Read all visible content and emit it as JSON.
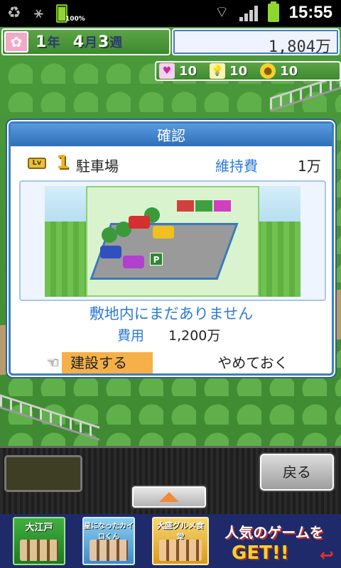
{
  "status_bar": {
    "battery_percent": "100%",
    "time": "15:55"
  },
  "hud": {
    "date": {
      "year": "1",
      "year_unit": "年",
      "month": "4",
      "month_unit": "月",
      "week": "3",
      "week_unit": "週"
    },
    "money": "1,804万",
    "stats": [
      {
        "icon": "heart-icon",
        "value": "10"
      },
      {
        "icon": "lightbulb-icon",
        "value": "10"
      },
      {
        "icon": "coin-icon",
        "value": "10"
      }
    ]
  },
  "dialog": {
    "title": "確認",
    "level_badge": "Lv",
    "level": "1",
    "facility_name": "駐車場",
    "upkeep_label": "維持費",
    "upkeep_value": "1万",
    "status_message": "敷地内にまだありません",
    "cost_label": "費用",
    "cost_value": "1,200万",
    "build_button": "建設する",
    "cancel_button": "やめておく"
  },
  "bottom_panel": {
    "back_button": "戻る"
  },
  "ads": [
    {
      "title": "大江戸"
    },
    {
      "title": "星になったカイロくん"
    },
    {
      "title": "大盛グルメ食堂"
    },
    {
      "title_line1": "人気のゲームを",
      "title_line2": "GET!!"
    }
  ],
  "colors": {
    "dialog_accent": "#3d7ec0",
    "label_blue": "#2c7ad6",
    "build_button_bg": "#f5b04a",
    "hud_green": "#4a9a3a"
  }
}
